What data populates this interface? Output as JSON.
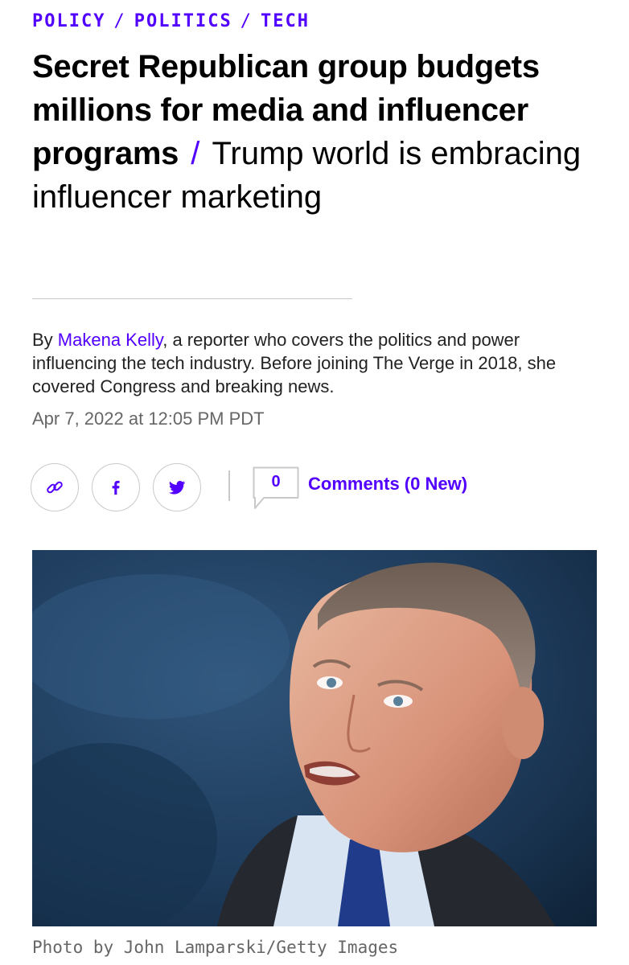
{
  "breadcrumbs": [
    {
      "label": "POLICY"
    },
    {
      "label": "POLITICS"
    },
    {
      "label": "TECH"
    }
  ],
  "breadcrumb_separator": "/",
  "article": {
    "title": "Secret Republican group budgets millions for media and influencer programs",
    "title_separator": "/",
    "dek": "Trump world is embracing influencer marketing",
    "byline_prefix": "By ",
    "author": "Makena Kelly",
    "author_bio": ", a reporter who covers the politics and power influencing the tech industry. Before joining The Verge in 2018, she covered Congress and breaking news.",
    "date": "Apr 7, 2022 at 12:05 PM PDT"
  },
  "share": {
    "icons": [
      "link-icon",
      "facebook-icon",
      "twitter-icon"
    ],
    "comment_count": "0",
    "comments_label": "Comments (0 New)"
  },
  "photo": {
    "credit": "Photo by John Lamparski/Getty Images"
  },
  "colors": {
    "accent": "#5200ff",
    "text": "#000000",
    "muted": "#666666",
    "border": "#c9c9c9"
  }
}
